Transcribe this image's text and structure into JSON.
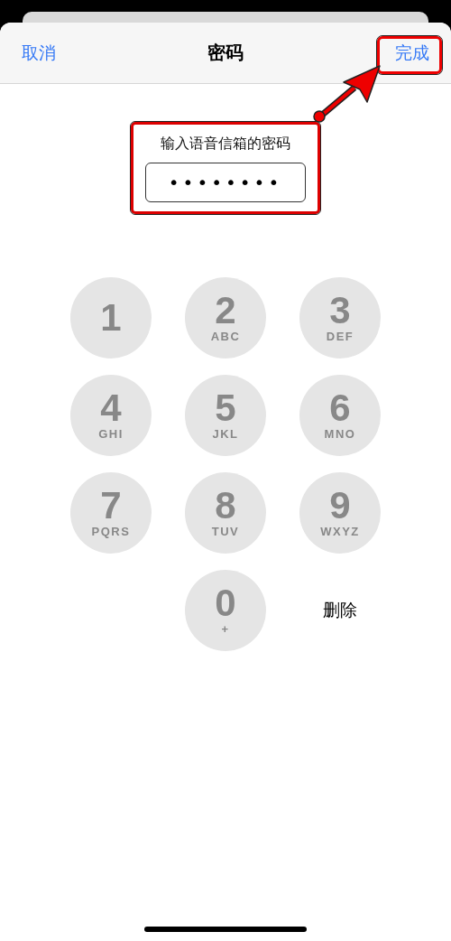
{
  "header": {
    "cancel": "取消",
    "title": "密码",
    "done": "完成"
  },
  "prompt": {
    "label": "输入语音信箱的密码",
    "value": "••••••••"
  },
  "keys": [
    {
      "kind": "digit",
      "digit": "1"
    },
    {
      "kind": "digit",
      "digit": "2",
      "letters": "ABC"
    },
    {
      "kind": "digit",
      "digit": "3",
      "letters": "DEF"
    },
    {
      "kind": "digit",
      "digit": "4",
      "letters": "GHI"
    },
    {
      "kind": "digit",
      "digit": "5",
      "letters": "JKL"
    },
    {
      "kind": "digit",
      "digit": "6",
      "letters": "MNO"
    },
    {
      "kind": "digit",
      "digit": "7",
      "letters": "PQRS"
    },
    {
      "kind": "digit",
      "digit": "8",
      "letters": "TUV"
    },
    {
      "kind": "digit",
      "digit": "9",
      "letters": "WXYZ"
    },
    {
      "kind": "digit",
      "digit": "0",
      "letters": "+"
    },
    {
      "kind": "action",
      "label": "删除"
    }
  ]
}
